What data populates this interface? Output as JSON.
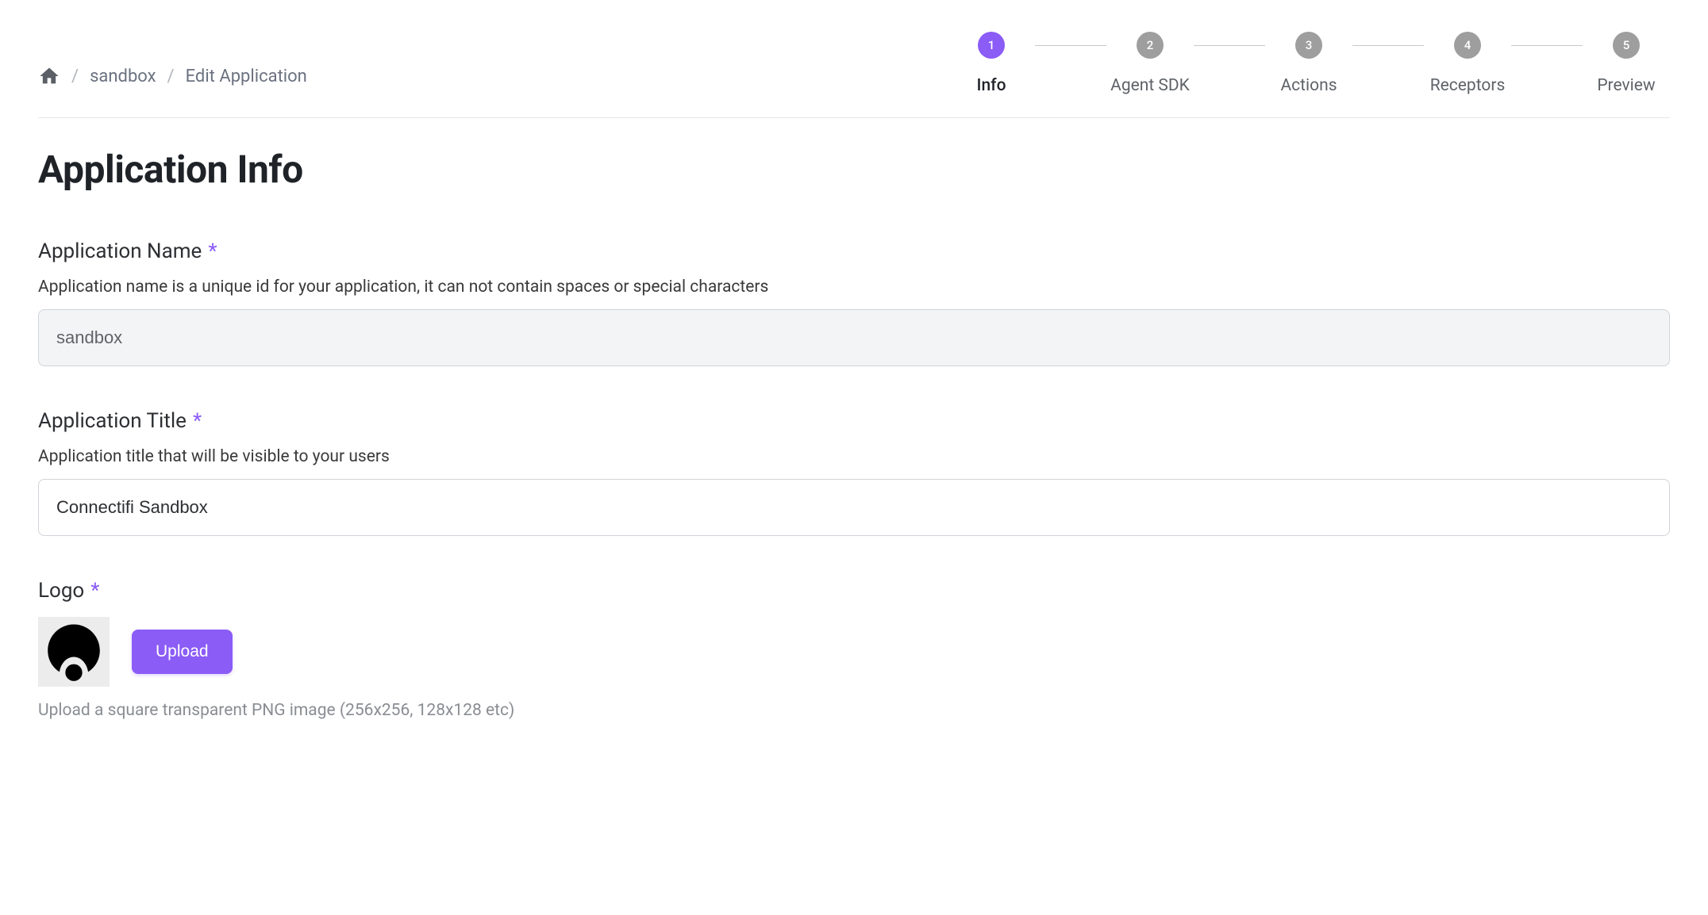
{
  "breadcrumb": {
    "items": [
      "sandbox",
      "Edit Application"
    ]
  },
  "stepper": {
    "steps": [
      {
        "num": "1",
        "label": "Info",
        "active": true
      },
      {
        "num": "2",
        "label": "Agent SDK",
        "active": false
      },
      {
        "num": "3",
        "label": "Actions",
        "active": false
      },
      {
        "num": "4",
        "label": "Receptors",
        "active": false
      },
      {
        "num": "5",
        "label": "Preview",
        "active": false
      }
    ]
  },
  "page": {
    "title": "Application Info"
  },
  "fields": {
    "name": {
      "label": "Application Name",
      "required": "*",
      "help": "Application name is a unique id for your application, it can not contain spaces or special characters",
      "value": "sandbox"
    },
    "title": {
      "label": "Application Title",
      "required": "*",
      "help": "Application title that will be visible to your users",
      "value": "Connectifi Sandbox"
    },
    "logo": {
      "label": "Logo",
      "required": "*",
      "upload_label": "Upload",
      "help": "Upload a square transparent PNG image (256x256, 128x128 etc)"
    }
  }
}
